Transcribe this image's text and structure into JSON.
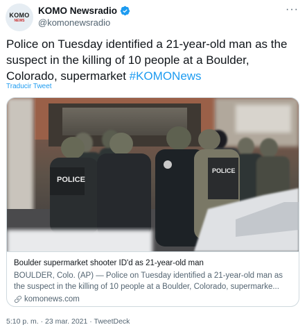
{
  "author": {
    "display_name": "KOMO Newsradio",
    "handle": "@komonewsradio",
    "avatar_text_top": "KOMO",
    "avatar_text_bottom": "NEWS"
  },
  "tweet": {
    "text": "Police on Tuesday identified a 21-year-old man as the suspect in the killing of 10 people at a Boulder, Colorado, supermarket ",
    "hashtag": "#KOMONews",
    "translate_label": "Traducir Tweet"
  },
  "card": {
    "title": "Boulder supermarket shooter ID'd as 21-year-old man",
    "description": "BOULDER, Colo. (AP) — Police on Tuesday identified a 21-year-old man as the suspect in the killing of 10 people at a Boulder, Colorado, supermarke...",
    "domain": "komonews.com",
    "photo_text": [
      "POLICE",
      "POLICE"
    ]
  },
  "meta": {
    "time": "5:10 p. m.",
    "separator": " · ",
    "date": "23 mar. 2021",
    "source": "TweetDeck"
  },
  "colors": {
    "accent": "#1d9bf0",
    "text": "#0f1419",
    "muted": "#536471",
    "border": "#cfd9de"
  },
  "icons": [
    "verified-badge-icon",
    "more-icon",
    "link-icon"
  ]
}
